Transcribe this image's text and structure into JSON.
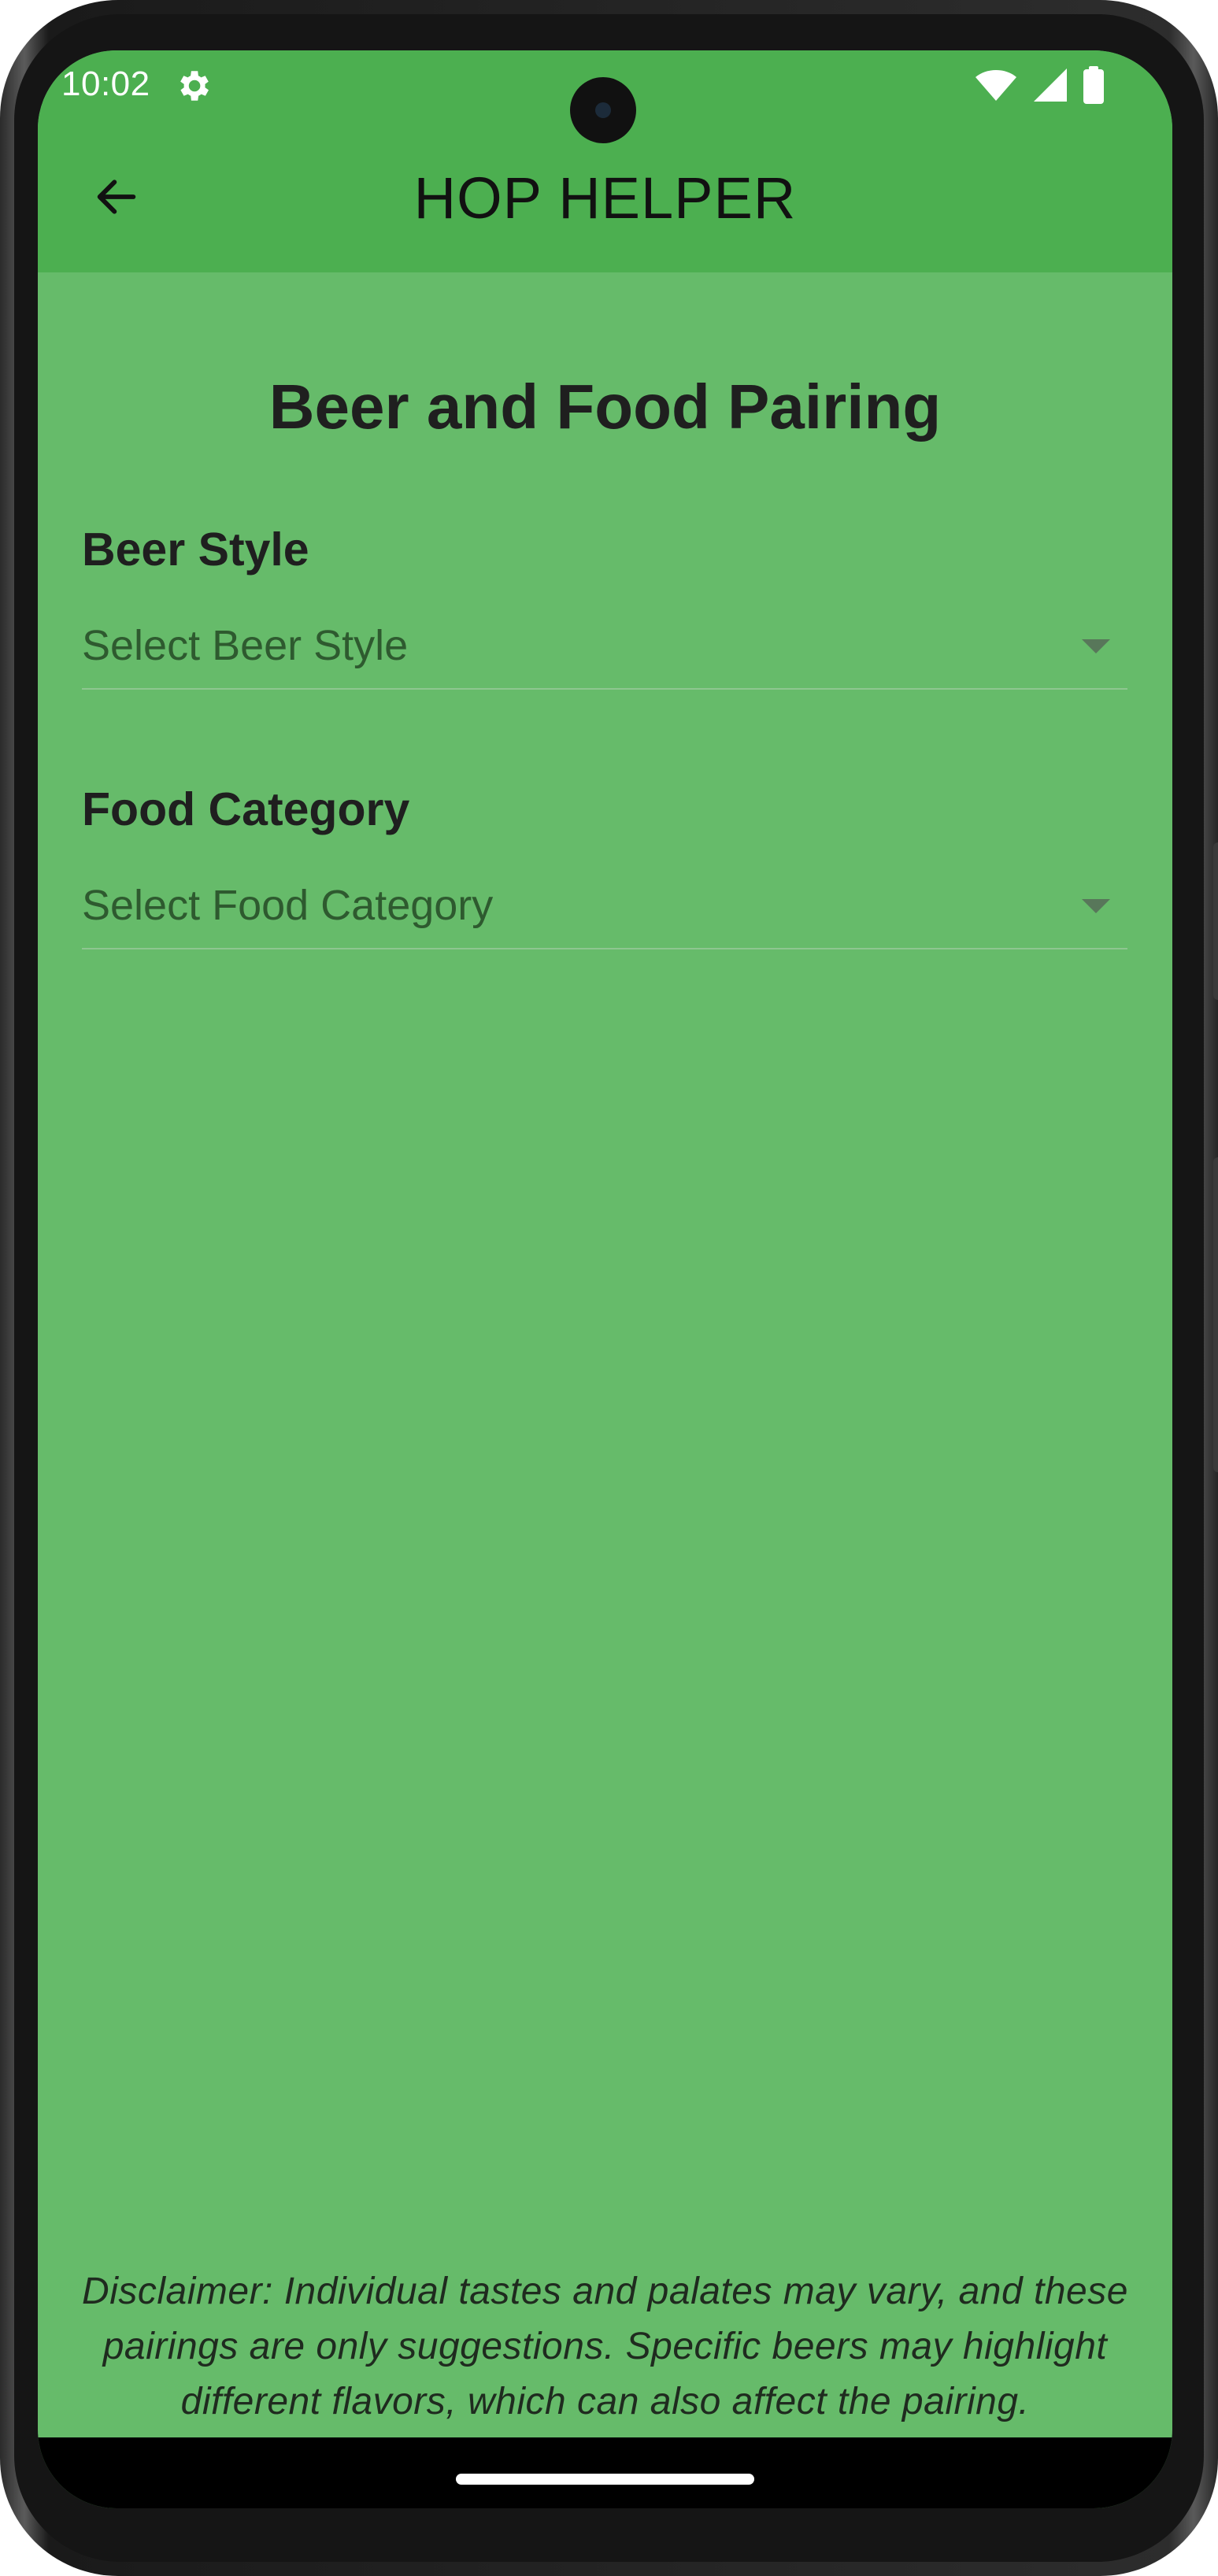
{
  "status_bar": {
    "time": "10:02",
    "icons": [
      "gear-icon",
      "wifi-icon",
      "cellular-signal-icon",
      "battery-icon"
    ]
  },
  "app_bar": {
    "title": "HOP HELPER",
    "back_icon": "arrow-left-icon"
  },
  "main": {
    "title": "Beer and Food Pairing",
    "beer_style": {
      "label": "Beer Style",
      "placeholder": "Select Beer Style"
    },
    "food_category": {
      "label": "Food Category",
      "placeholder": "Select Food Category"
    },
    "disclaimer": "Disclaimer: Individual tastes and palates may vary, and these pairings are only suggestions. Specific beers may highlight different flavors, which can also affect the pairing."
  },
  "colors": {
    "app_bar": "#4caf50",
    "background": "#66bb6a",
    "text": "#1f1f1f"
  }
}
